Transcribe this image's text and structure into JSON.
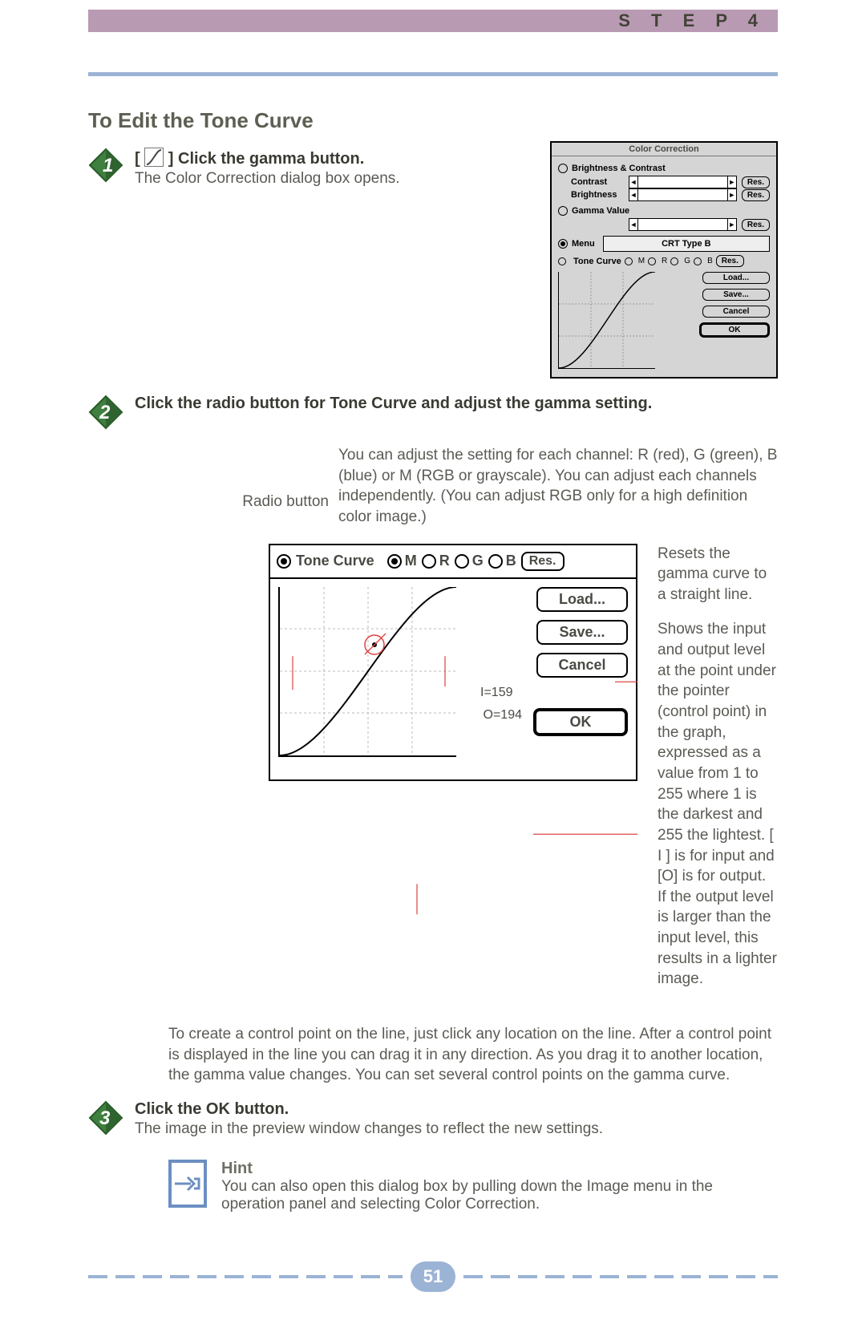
{
  "header": {
    "step_label": "S  T  E  P   4"
  },
  "section_title": "To Edit the Tone Curve",
  "steps": {
    "s1": {
      "title_pre": "[",
      "title_post": "] Click the gamma button.",
      "body": "The Color Correction dialog box opens."
    },
    "s2": {
      "title": "Click the radio button for Tone Curve and adjust the gamma setting.",
      "intro": "You can adjust the setting for each channel: R (red), G (green), B (blue) or M (RGB or grayscale).  You can adjust each channels independently.  (You can adjust RGB only for a high definition color image.)",
      "radio_caption": "Radio button",
      "reset_note": "Resets the gamma curve to a straight line.",
      "io_note": "Shows the input and output level at the point under the pointer (control point) in the graph, expressed as a value from 1 to 255 where 1 is the darkest and 255 the lightest. [ I ] is for input and [O] is for output. If the output level is larger than the input level, this results in a lighter image.",
      "after": "To create a control point on the line, just click any location on the line.  After a control point is displayed in the line you can drag it in any direction.  As you drag it to another location, the gamma value changes.  You can set several control points on the gamma curve."
    },
    "s3": {
      "title": "Click the OK button.",
      "body": "The image in the preview window changes to reflect the new settings."
    }
  },
  "hint": {
    "title": "Hint",
    "body": "You can also open this dialog box by pulling down the Image menu in the operation panel and selecting Color Correction."
  },
  "dialog": {
    "title": "Color Correction",
    "brightness_contrast": "Brightness & Contrast",
    "contrast": "Contrast",
    "brightness": "Brightness",
    "gamma_value": "Gamma Value",
    "menu": "Menu",
    "menu_value": "CRT Type B",
    "tone_curve": "Tone Curve",
    "channels": {
      "m": "M",
      "r": "R",
      "g": "G",
      "b": "B"
    },
    "res": "Res.",
    "buttons": {
      "load": "Load...",
      "save": "Save...",
      "cancel": "Cancel",
      "ok": "OK"
    }
  },
  "tc_fig": {
    "label": "Tone Curve",
    "i_label": "I=159",
    "o_label": "O=194"
  },
  "page_number": "51"
}
